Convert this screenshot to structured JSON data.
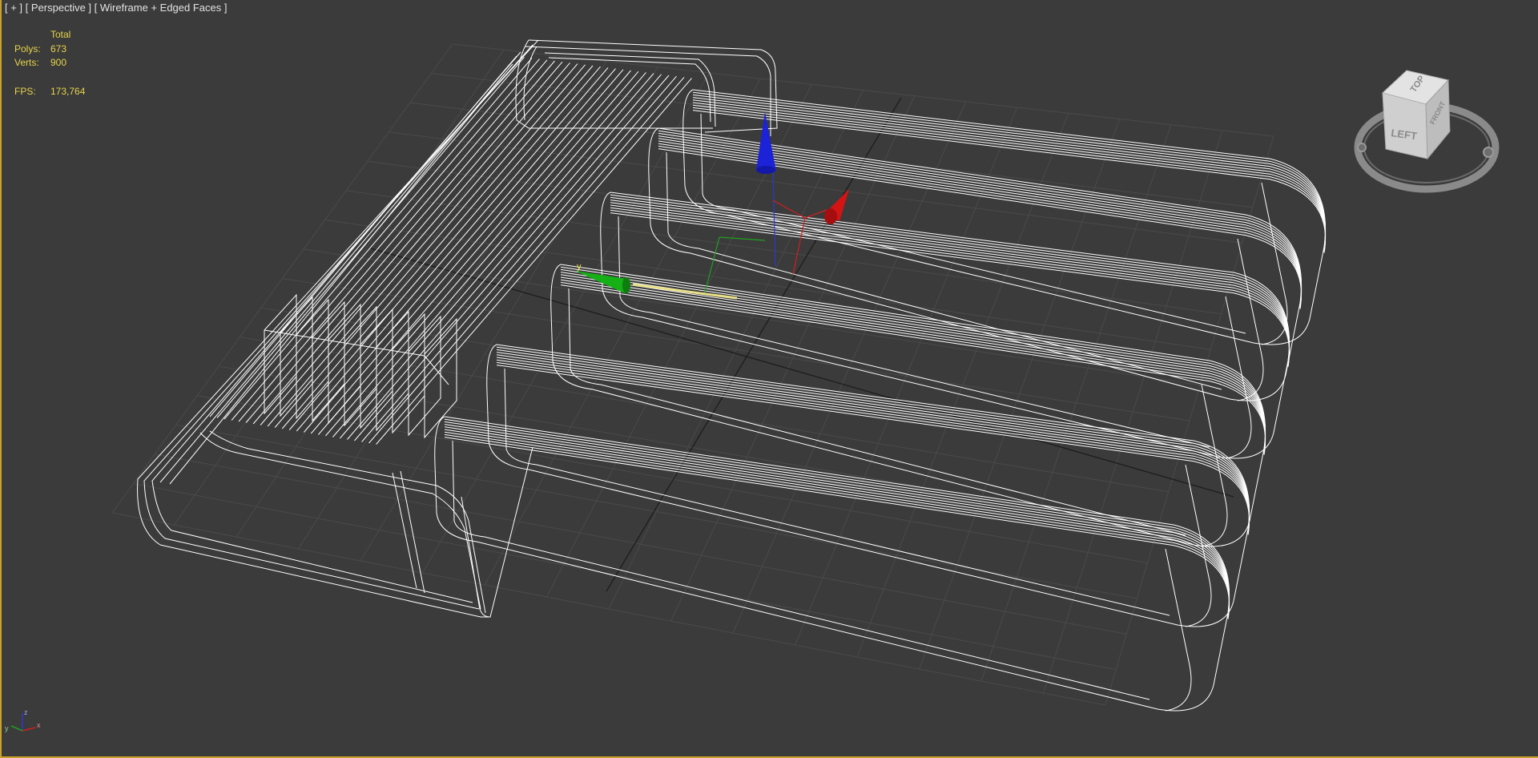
{
  "viewport": {
    "label": "[ + ] [ Perspective ] [ Wireframe + Edged Faces ]",
    "label_parts": [
      "[ + ]",
      "[ Perspective ]",
      "[ Wireframe + Edged Faces ]"
    ]
  },
  "stats": {
    "header": "Total",
    "polys_label": "Polys:",
    "polys_value": "673",
    "verts_label": "Verts:",
    "verts_value": "900",
    "fps_label": "FPS:",
    "fps_value": "173,764"
  },
  "viewcube": {
    "face_left": "LEFT",
    "face_top": "TOP",
    "face_front": "FRONT"
  },
  "gizmo": {
    "y_label": "y",
    "z_label": "z",
    "x_label": "x"
  },
  "axis_tripod": {
    "z": "z",
    "y": "y",
    "x": "x"
  },
  "colors": {
    "background": "#3b3b3b",
    "grid": "#4a4a4a",
    "wire": "#ffffff",
    "stats_text": "#e6d34a",
    "axis_x": "#d21f1f",
    "axis_y": "#1fa01f",
    "axis_z": "#1f2fd2",
    "active_border": "#c9a227"
  }
}
